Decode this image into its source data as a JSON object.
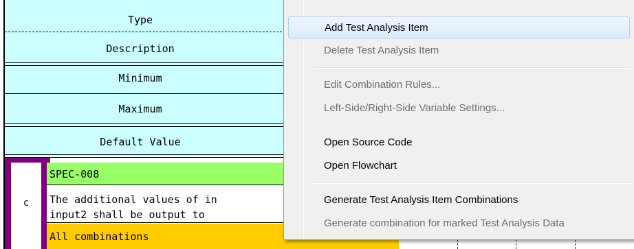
{
  "header_rows": {
    "type": "Type",
    "description": "Description",
    "minimum": "Minimum",
    "maximum": "Maximum",
    "default_value": "Default Value"
  },
  "spec": {
    "row_marker": "c",
    "id": "SPEC-008",
    "description_line1": "The additional values of in",
    "description_line2": "input2 shall be output to ",
    "combination": "All combinations"
  },
  "context_menu": {
    "items": [
      {
        "label": "Add Test Analysis Item",
        "enabled": true
      },
      {
        "label": "Delete Test Analysis Item",
        "enabled": false
      },
      {
        "label": "Edit Combination Rules...",
        "enabled": false
      },
      {
        "label": "Left-Side/Right-Side Variable Settings...",
        "enabled": false
      },
      {
        "label": "Open Source Code",
        "enabled": true
      },
      {
        "label": "Open Flowchart",
        "enabled": true
      },
      {
        "label": "Generate Test Analysis Item Combinations",
        "enabled": true
      },
      {
        "label": "Generate combination for marked Test Analysis Data",
        "enabled": false
      }
    ]
  },
  "colors": {
    "header_bg": "#ccffff",
    "spec_id_bg": "#99ff66",
    "combination_bg": "#ffcc00",
    "spec_border": "#800080",
    "menu_bg": "#f0f0f0",
    "menu_highlight": "#dcebfc"
  }
}
